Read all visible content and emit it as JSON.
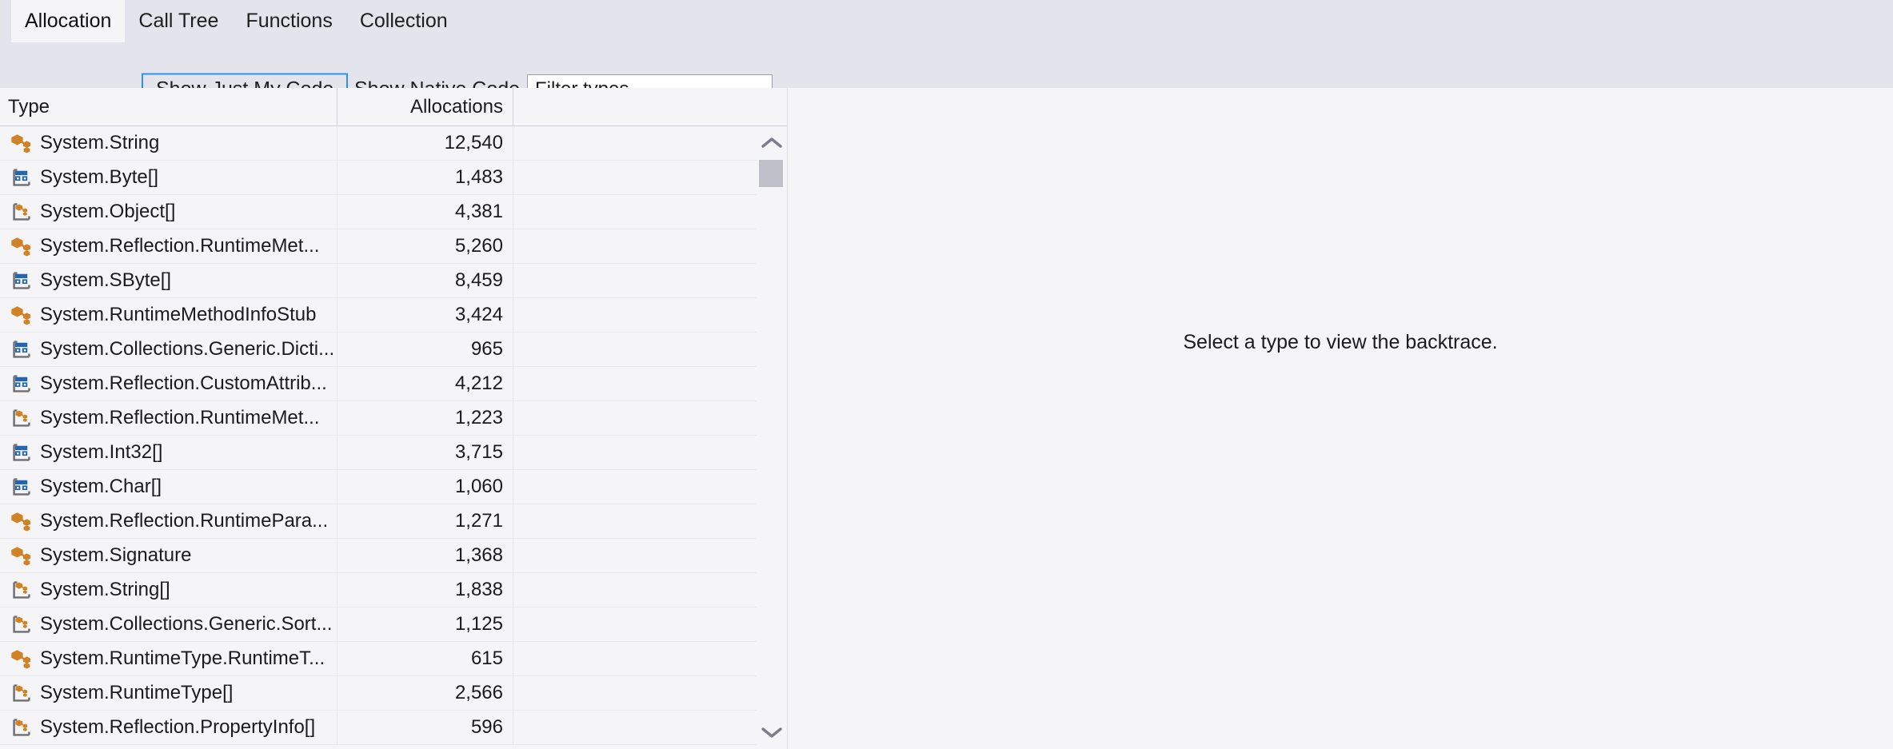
{
  "tabs": [
    {
      "label": "Allocation",
      "selected": true
    },
    {
      "label": "Call Tree",
      "selected": false
    },
    {
      "label": "Functions",
      "selected": false
    },
    {
      "label": "Collection",
      "selected": false
    }
  ],
  "toolbar": {
    "show_just_my_code_label": "Show Just My Code",
    "show_native_code_label": "Show Native Code",
    "filter_value": "Filter types",
    "filter_placeholder": "Filter types",
    "focus_color": "#2b93f0"
  },
  "table": {
    "columns": [
      {
        "key": "type",
        "label": "Type",
        "align": "left"
      },
      {
        "key": "allocations",
        "label": "Allocations",
        "align": "right"
      }
    ],
    "rows": [
      {
        "icon": "class-icon",
        "type": "System.String",
        "allocations": "12,540"
      },
      {
        "icon": "struct-array-icon",
        "type": "System.Byte[]",
        "allocations": "1,483"
      },
      {
        "icon": "class-array-icon",
        "type": "System.Object[]",
        "allocations": "4,381"
      },
      {
        "icon": "class-icon",
        "type": "System.Reflection.RuntimeMet...",
        "allocations": "5,260"
      },
      {
        "icon": "struct-array-icon",
        "type": "System.SByte[]",
        "allocations": "8,459"
      },
      {
        "icon": "class-icon",
        "type": "System.RuntimeMethodInfoStub",
        "allocations": "3,424"
      },
      {
        "icon": "struct-array-icon",
        "type": "System.Collections.Generic.Dicti...",
        "allocations": "965"
      },
      {
        "icon": "struct-array-icon",
        "type": "System.Reflection.CustomAttrib...",
        "allocations": "4,212"
      },
      {
        "icon": "class-array-icon",
        "type": "System.Reflection.RuntimeMet...",
        "allocations": "1,223"
      },
      {
        "icon": "struct-array-icon",
        "type": "System.Int32[]",
        "allocations": "3,715"
      },
      {
        "icon": "struct-array-icon",
        "type": "System.Char[]",
        "allocations": "1,060"
      },
      {
        "icon": "class-icon",
        "type": "System.Reflection.RuntimePara...",
        "allocations": "1,271"
      },
      {
        "icon": "class-icon",
        "type": "System.Signature",
        "allocations": "1,368"
      },
      {
        "icon": "class-array-icon",
        "type": "System.String[]",
        "allocations": "1,838"
      },
      {
        "icon": "class-array-icon",
        "type": "System.Collections.Generic.Sort...",
        "allocations": "1,125"
      },
      {
        "icon": "class-icon",
        "type": "System.RuntimeType.RuntimeT...",
        "allocations": "615"
      },
      {
        "icon": "class-array-icon",
        "type": "System.RuntimeType[]",
        "allocations": "2,566"
      },
      {
        "icon": "class-array-icon",
        "type": "System.Reflection.PropertyInfo[]",
        "allocations": "596"
      }
    ]
  },
  "scrollbar": {
    "up_icon": "chevron-up-icon",
    "down_icon": "chevron-down-icon"
  },
  "details_pane": {
    "empty_message": "Select a type to view the backtrace."
  }
}
